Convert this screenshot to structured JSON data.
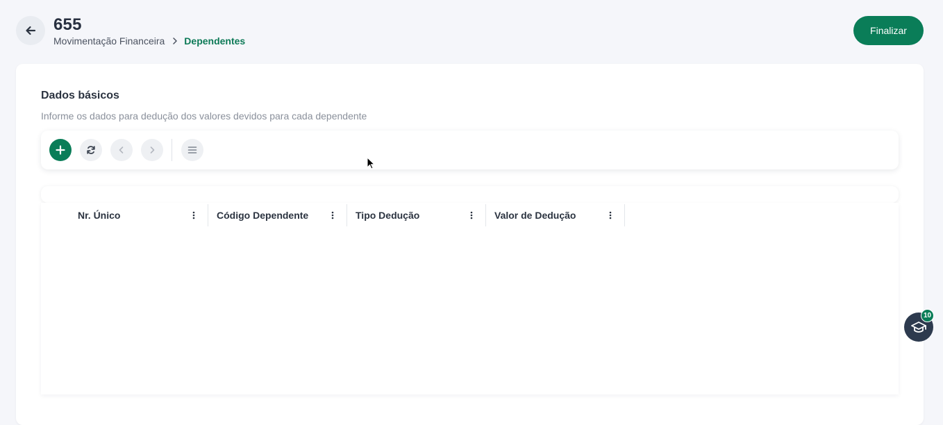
{
  "header": {
    "title": "655",
    "breadcrumb": {
      "parent": "Movimentação Financeira",
      "current": "Dependentes"
    },
    "finalize_label": "Finalizar"
  },
  "section": {
    "title": "Dados básicos",
    "subtitle": "Informe os dados para dedução dos valores devidos para cada dependente"
  },
  "toolbar": {
    "buttons": [
      {
        "icon": "plus-icon",
        "enabled": true
      },
      {
        "icon": "refresh-icon",
        "enabled": true
      },
      {
        "icon": "chevron-left-icon",
        "enabled": false
      },
      {
        "icon": "chevron-right-icon",
        "enabled": false
      },
      {
        "icon": "menu-icon",
        "enabled": true
      }
    ]
  },
  "grid": {
    "columns": [
      {
        "label": "Nr. Único"
      },
      {
        "label": "Código Dependente"
      },
      {
        "label": "Tipo Dedução"
      },
      {
        "label": "Valor de Dedução"
      }
    ],
    "rows": []
  },
  "help": {
    "badge_count": "10",
    "icon": "graduation-cap-icon"
  },
  "colors": {
    "accent": "#0a7d58",
    "text": "#2b3340",
    "muted": "#8a909b",
    "fab": "#2d3a4e"
  }
}
